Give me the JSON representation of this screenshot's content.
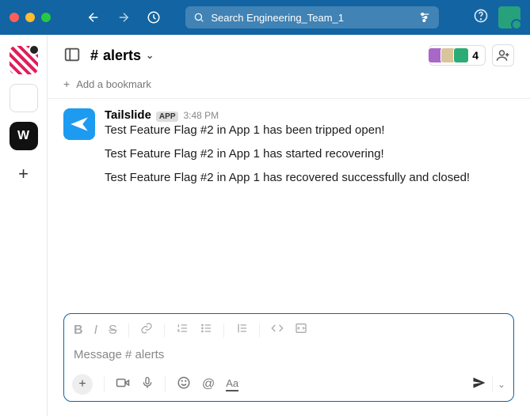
{
  "titlebar": {
    "search_prefix": "Search",
    "workspace_name": "Engineering_Team_1"
  },
  "rail": {
    "ws3_label": "W"
  },
  "channel": {
    "hash": "#",
    "name": "alerts",
    "member_count": "4"
  },
  "bookmark": {
    "label": "Add a bookmark"
  },
  "message": {
    "author": "Tailslide",
    "badge": "APP",
    "time": "3:48 PM",
    "line1": "Test Feature Flag #2 in App 1 has been tripped open!",
    "line2": "Test Feature Flag #2 in App 1 has started recovering!",
    "line3": "Test Feature Flag #2 in App 1 has recovered successfully and closed!"
  },
  "composer": {
    "placeholder_prefix": "Message",
    "placeholder_channel": "# alerts"
  }
}
